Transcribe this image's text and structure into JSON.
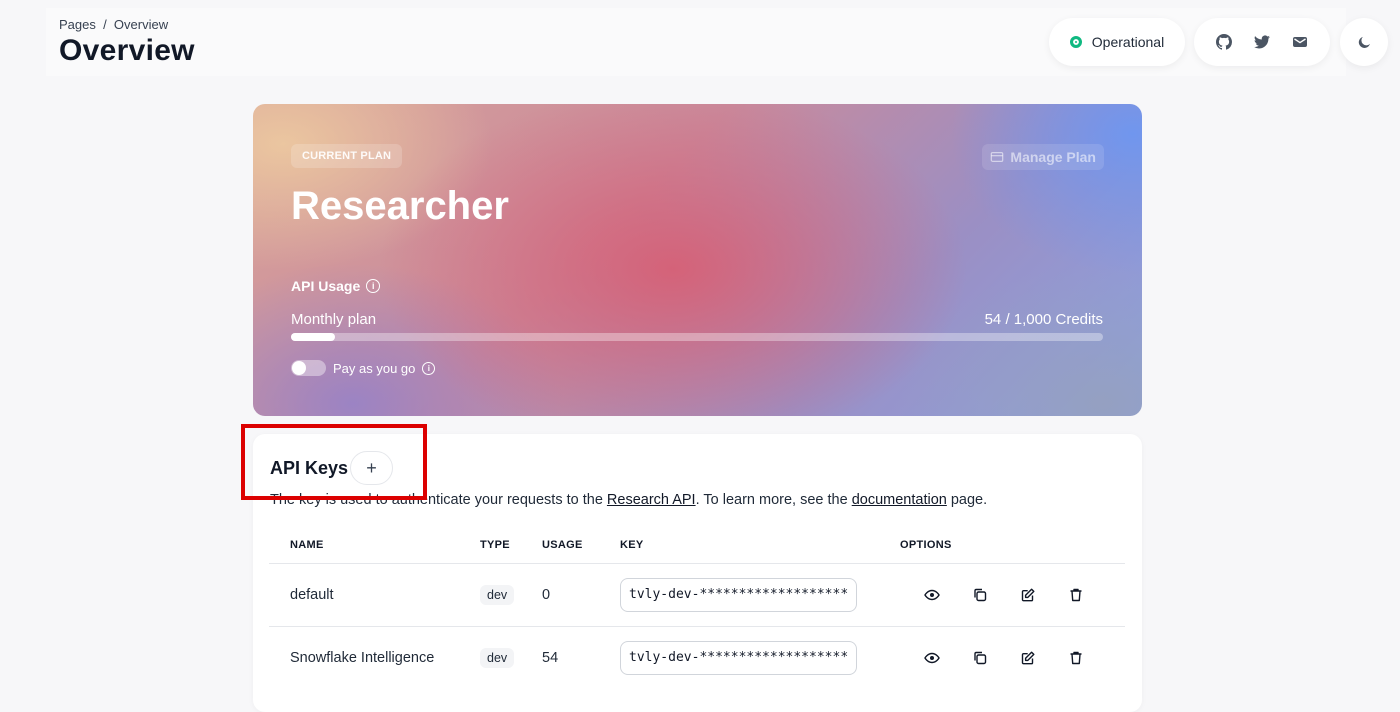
{
  "header": {
    "breadcrumb": "Pages  /  Overview",
    "title": "Overview",
    "status_label": "Operational",
    "status_color": "#10b981",
    "social_icons": [
      "github-icon",
      "twitter-icon",
      "mail-icon"
    ],
    "theme_icon": "moon-icon"
  },
  "plan": {
    "badge": "CURRENT PLAN",
    "manage_label": "Manage Plan",
    "name": "Researcher",
    "usage_title": "API Usage",
    "monthly_label": "Monthly plan",
    "credits_label": "54 / 1,000 Credits",
    "credits_used": 54,
    "credits_total": 1000,
    "payg_label": "Pay as you go",
    "payg_enabled": false
  },
  "keys": {
    "title": "API Keys",
    "add_label": "+",
    "desc_prefix": "The key is used to authenticate your requests to the ",
    "desc_link1": "Research API",
    "desc_middle": ". To learn more, see the ",
    "desc_link2": "documentation",
    "desc_suffix": " page.",
    "columns": [
      "NAME",
      "TYPE",
      "USAGE",
      "KEY",
      "OPTIONS"
    ],
    "rows": [
      {
        "name": "default",
        "type": "dev",
        "usage": "0",
        "key": "tvly-dev-********************************"
      },
      {
        "name": "Snowflake Intelligence",
        "type": "dev",
        "usage": "54",
        "key": "tvly-dev-********************************"
      }
    ],
    "option_icons": [
      "eye-icon",
      "copy-icon",
      "edit-icon",
      "trash-icon"
    ]
  }
}
